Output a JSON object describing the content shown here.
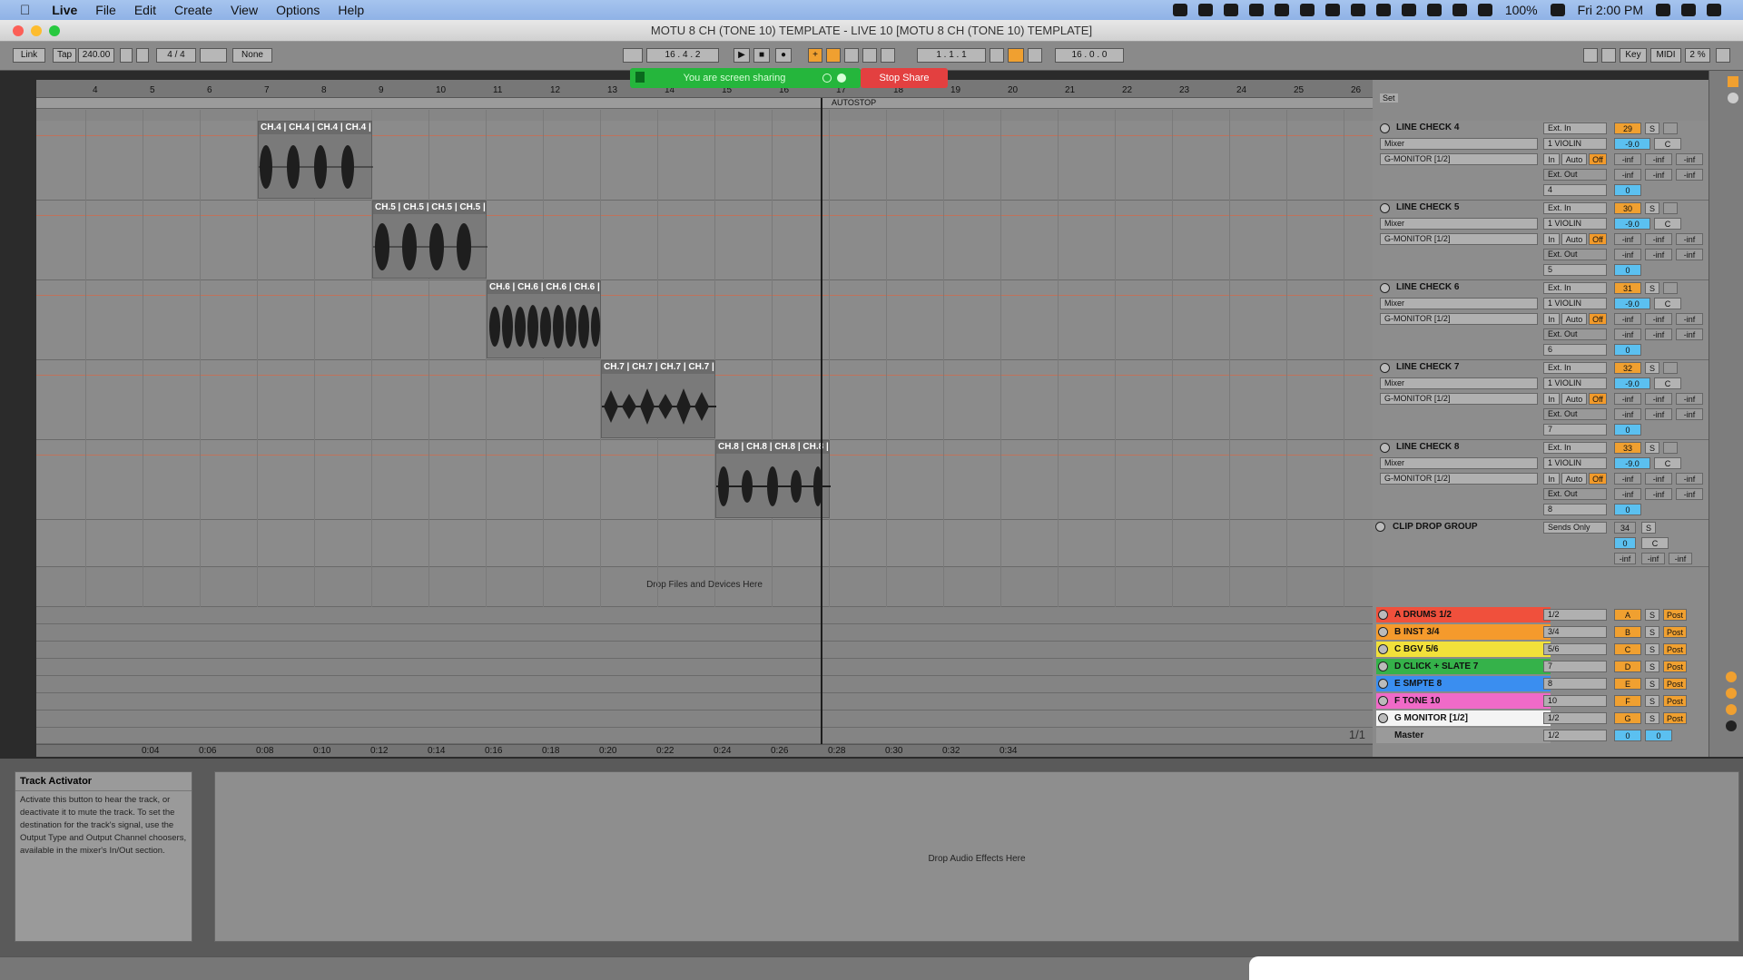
{
  "menubar": {
    "app": "Live",
    "items": [
      "File",
      "Edit",
      "Create",
      "View",
      "Options",
      "Help"
    ],
    "battery": "100%",
    "clock": "Fri 2:00 PM"
  },
  "window": {
    "title": "MOTU 8 CH (TONE 10) TEMPLATE - LIVE 10  [MOTU 8 CH (TONE 10) TEMPLATE]"
  },
  "control": {
    "link": "Link",
    "tap": "Tap",
    "tempo": "240.00",
    "signature": "4 / 4",
    "quantize": "None",
    "position": "16 .   4 .   2",
    "loop_start": "1 .   1 .   1",
    "loop_length": "16 .   0 .   0",
    "key": "Key",
    "midi": "MIDI",
    "cpu": "2 %"
  },
  "share": {
    "banner": "You are screen sharing",
    "stop": "Stop Share"
  },
  "arrangement": {
    "ruler": [
      "4",
      "5",
      "6",
      "7",
      "8",
      "9",
      "10",
      "11",
      "12",
      "13",
      "14",
      "15",
      "16",
      "17",
      "18",
      "19",
      "20",
      "21",
      "22",
      "23",
      "24",
      "25",
      "26"
    ],
    "autostop": "AUTOSTOP",
    "drop_hint": "Drop Files and Devices Here",
    "time_ruler": [
      "0:04",
      "0:06",
      "0:08",
      "0:10",
      "0:12",
      "0:14",
      "0:16",
      "0:18",
      "0:20",
      "0:22",
      "0:24",
      "0:26",
      "0:28",
      "0:30",
      "0:32",
      "0:34"
    ],
    "page": "1/1",
    "clips": [
      {
        "label": "CH.4 | CH.4 | CH.4 | CH.4 |"
      },
      {
        "label": "CH.5 | CH.5 | CH.5 | CH.5 |"
      },
      {
        "label": "CH.6 | CH.6 | CH.6 | CH.6 |"
      },
      {
        "label": "CH.7 | CH.7 | CH.7 | CH.7 |"
      },
      {
        "label": "CH.8 | CH.8 | CH.8 | CH.8 |"
      }
    ]
  },
  "set_label": "Set",
  "tracks": [
    {
      "name": "LINE CHECK 4",
      "input": "Ext. In",
      "sub": "Mixer",
      "channel": "1 VIOLIN",
      "monitor": "G-MONITOR [1/2]",
      "out": "Ext. Out",
      "out_ch": "4",
      "num": "29",
      "vol": "-9.0",
      "pan": "C",
      "send": "0"
    },
    {
      "name": "LINE CHECK 5",
      "input": "Ext. In",
      "sub": "Mixer",
      "channel": "1 VIOLIN",
      "monitor": "G-MONITOR [1/2]",
      "out": "Ext. Out",
      "out_ch": "5",
      "num": "30",
      "vol": "-9.0",
      "pan": "C",
      "send": "0"
    },
    {
      "name": "LINE CHECK 6",
      "input": "Ext. In",
      "sub": "Mixer",
      "channel": "1 VIOLIN",
      "monitor": "G-MONITOR [1/2]",
      "out": "Ext. Out",
      "out_ch": "6",
      "num": "31",
      "vol": "-9.0",
      "pan": "C",
      "send": "0"
    },
    {
      "name": "LINE CHECK 7",
      "input": "Ext. In",
      "sub": "Mixer",
      "channel": "1 VIOLIN",
      "monitor": "G-MONITOR [1/2]",
      "out": "Ext. Out",
      "out_ch": "7",
      "num": "32",
      "vol": "-9.0",
      "pan": "C",
      "send": "0"
    },
    {
      "name": "LINE CHECK 8",
      "input": "Ext. In",
      "sub": "Mixer",
      "channel": "1 VIOLIN",
      "monitor": "G-MONITOR [1/2]",
      "out": "Ext. Out",
      "out_ch": "8",
      "num": "33",
      "vol": "-9.0",
      "pan": "C",
      "send": "0"
    }
  ],
  "monitor_labels": {
    "in": "In",
    "auto": "Auto",
    "off": "Off",
    "inf": "-inf",
    "s": "S"
  },
  "group": {
    "name": "CLIP DROP GROUP",
    "mode": "Sends Only",
    "num": "34",
    "vol": "0",
    "pan": "C"
  },
  "returns": [
    {
      "name": "A DRUMS 1/2",
      "out": "1/2",
      "letter": "A",
      "color": "#f0503c",
      "post": "Post"
    },
    {
      "name": "B INST 3/4",
      "out": "3/4",
      "letter": "B",
      "color": "#f59a2c",
      "post": "Post"
    },
    {
      "name": "C BGV 5/6",
      "out": "5/6",
      "letter": "C",
      "color": "#f2e13a",
      "post": "Post"
    },
    {
      "name": "D CLICK + SLATE 7",
      "out": "7",
      "letter": "D",
      "color": "#35b24a",
      "post": "Post"
    },
    {
      "name": "E SMPTE 8",
      "out": "8",
      "letter": "E",
      "color": "#3a8ef0",
      "post": "Post"
    },
    {
      "name": "F TONE 10",
      "out": "10",
      "letter": "F",
      "color": "#f06ac8",
      "post": "Post"
    },
    {
      "name": "G MONITOR [1/2]",
      "out": "1/2",
      "letter": "G",
      "color": "#f4f4f4",
      "post": "Post"
    }
  ],
  "master": {
    "name": "Master",
    "out": "1/2",
    "vol": "0",
    "pan": "0"
  },
  "info": {
    "title": "Track Activator",
    "body": "Activate this button to hear the track, or deactivate it to mute the track. To set the destination for the track's signal, use the Output Type and Output Channel choosers, available in the mixer's In/Out section."
  },
  "detail": {
    "drop_effects": "Drop Audio Effects Here"
  }
}
